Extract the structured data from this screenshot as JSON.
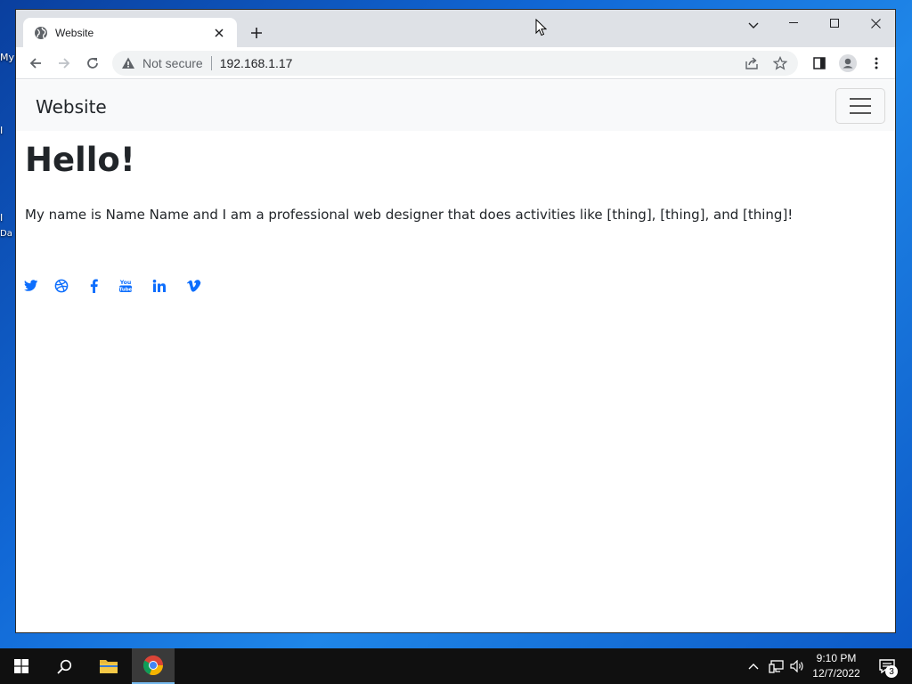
{
  "desktop": {
    "icon_fragments": [
      "My",
      "I",
      "I",
      "Da"
    ]
  },
  "browser": {
    "tab": {
      "title": "Website",
      "favicon": "globe-icon"
    },
    "window_controls": [
      "minimize-icon",
      "maximize-icon",
      "close-icon"
    ],
    "omnibox": {
      "security_label": "Not secure",
      "url": "192.168.1.17"
    }
  },
  "page": {
    "brand": "Website",
    "heading": "Hello!",
    "intro": "My name is Name Name and I am a professional web designer that does activities like [thing], [thing], and [thing]!",
    "social_links": [
      "twitter",
      "dribbble",
      "facebook",
      "youtube",
      "linkedin",
      "vimeo"
    ],
    "accent_color": "#0d6efd"
  },
  "taskbar": {
    "apps": [
      "start",
      "search",
      "file-explorer",
      "chrome"
    ],
    "time": "9:10 PM",
    "date": "12/7/2022",
    "notification_count": "3"
  }
}
